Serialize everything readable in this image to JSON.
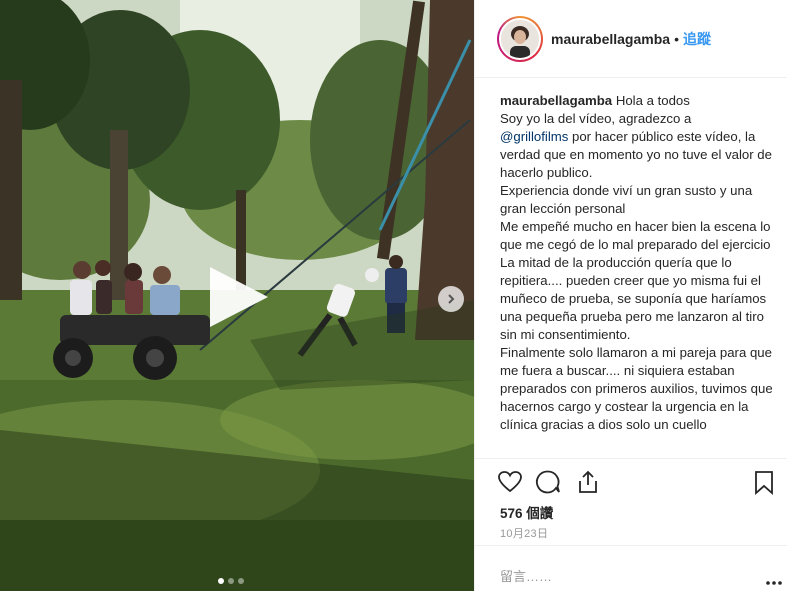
{
  "header": {
    "username": "maurabellagamba",
    "separator": "•",
    "follow_label": "追蹤"
  },
  "caption": {
    "username": "maurabellagamba",
    "first_line": "Hola a todos",
    "para1_a": "Soy yo la del vídeo, agradezco a",
    "mention": "@grillofilms",
    "para1_b": " por hacer público este vídeo, la verdad que en momento yo no tuve el valor de hacerlo publico.",
    "para2": "Experiencia donde viví un gran susto y una gran lección personal",
    "para3": "Me empeñé mucho en hacer bien la escena lo que me cegó de lo mal preparado del ejercicio",
    "para4": "La mitad de la producción quería que lo repitiera.... pueden creer que yo misma fui el muñeco de prueba, se suponía que haríamos una pequeña prueba pero me lanzaron al tiro sin mi consentimiento.",
    "para5": "Finalmente solo llamaron a mi pareja para que me fuera a buscar.... ni siquiera estaban preparados con primeros auxilios, tuvimos que hacernos cargo y costear la urgencia en la clínica gracias a dios solo un cuello"
  },
  "stats": {
    "views": "576 個讚",
    "date": "10月23日"
  },
  "comment": {
    "placeholder": "留言……"
  },
  "media": {
    "carousel_total": 3,
    "carousel_active": 0
  },
  "icons": {
    "like": "heart-icon",
    "comment": "comment-icon",
    "share": "share-icon",
    "save": "bookmark-icon",
    "play": "play-icon",
    "next": "chevron-right-icon",
    "more": "more-options-icon"
  },
  "colors": {
    "follow": "#3897f0",
    "mention": "#003569",
    "secondary_text": "#999999"
  }
}
